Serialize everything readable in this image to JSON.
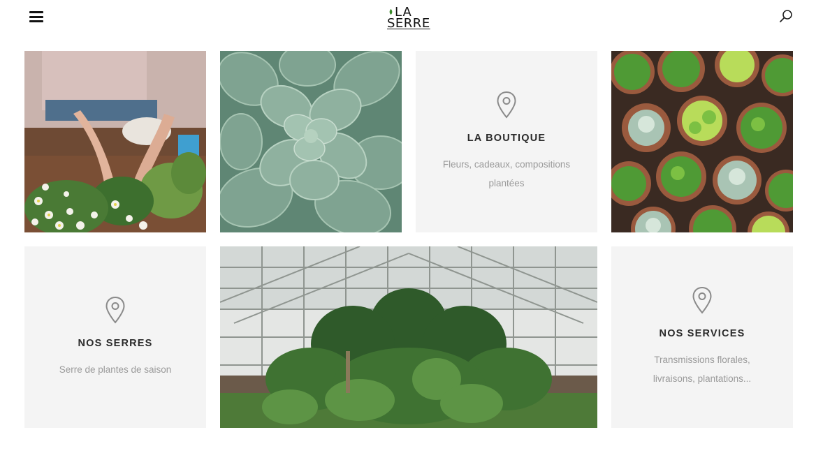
{
  "header": {
    "menu_icon": "hamburger-menu-icon",
    "logo": {
      "line1": "LA",
      "line2": "SERRE",
      "leaf_color": "#3a8a2a"
    },
    "search_icon": "search-icon"
  },
  "tiles": {
    "photo1": {
      "subject": "hands arranging flowers"
    },
    "photo2": {
      "subject": "succulent rosette"
    },
    "boutique": {
      "icon": "location-pin-icon",
      "title": "LA BOUTIQUE",
      "desc": "Fleurs, cadeaux, compositions plantées"
    },
    "photo3": {
      "subject": "potted succulents from above"
    },
    "serres": {
      "icon": "location-pin-icon",
      "title": "NOS SERRES",
      "desc": "Serre de plantes de saison"
    },
    "photo4": {
      "subject": "greenhouse interior with plants"
    },
    "services": {
      "icon": "location-pin-icon",
      "title": "NOS SERVICES",
      "desc": "Transmissions florales, livraisons, plantations..."
    }
  },
  "colors": {
    "card_bg": "#f4f4f4",
    "title": "#2a2a2a",
    "desc": "#9a9a9a",
    "icon": "#8a8a8a"
  }
}
